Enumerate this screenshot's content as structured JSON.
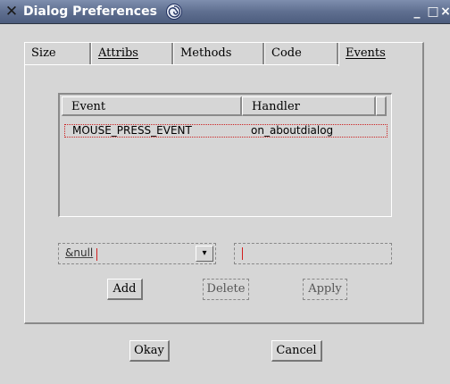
{
  "window": {
    "title": "Dialog Preferences",
    "close_glyph": "✕",
    "min_glyph": "_",
    "max_glyph": "□",
    "xclose_glyph": "×"
  },
  "tabs": [
    {
      "label": "Size",
      "active": false
    },
    {
      "label": "Attribs",
      "active": false
    },
    {
      "label": "Methods",
      "active": false
    },
    {
      "label": "Code",
      "active": false
    },
    {
      "label": "Events",
      "active": true
    }
  ],
  "events_table": {
    "columns": [
      "Event",
      "Handler"
    ],
    "rows": [
      {
        "event": "MOUSE_PRESS_EVENT",
        "handler": "on_aboutdialog"
      }
    ]
  },
  "event_combo": {
    "value": "&null",
    "arrow_glyph": "▾"
  },
  "handler_input": {
    "value": ""
  },
  "buttons": {
    "add": "Add",
    "delete": "Delete",
    "apply": "Apply",
    "okay": "Okay",
    "cancel": "Cancel"
  },
  "colors": {
    "titlebar": "#5f6f90",
    "background": "#d6d6d6",
    "selection_outline": "#cc2222",
    "caret": "#d21e1e"
  }
}
